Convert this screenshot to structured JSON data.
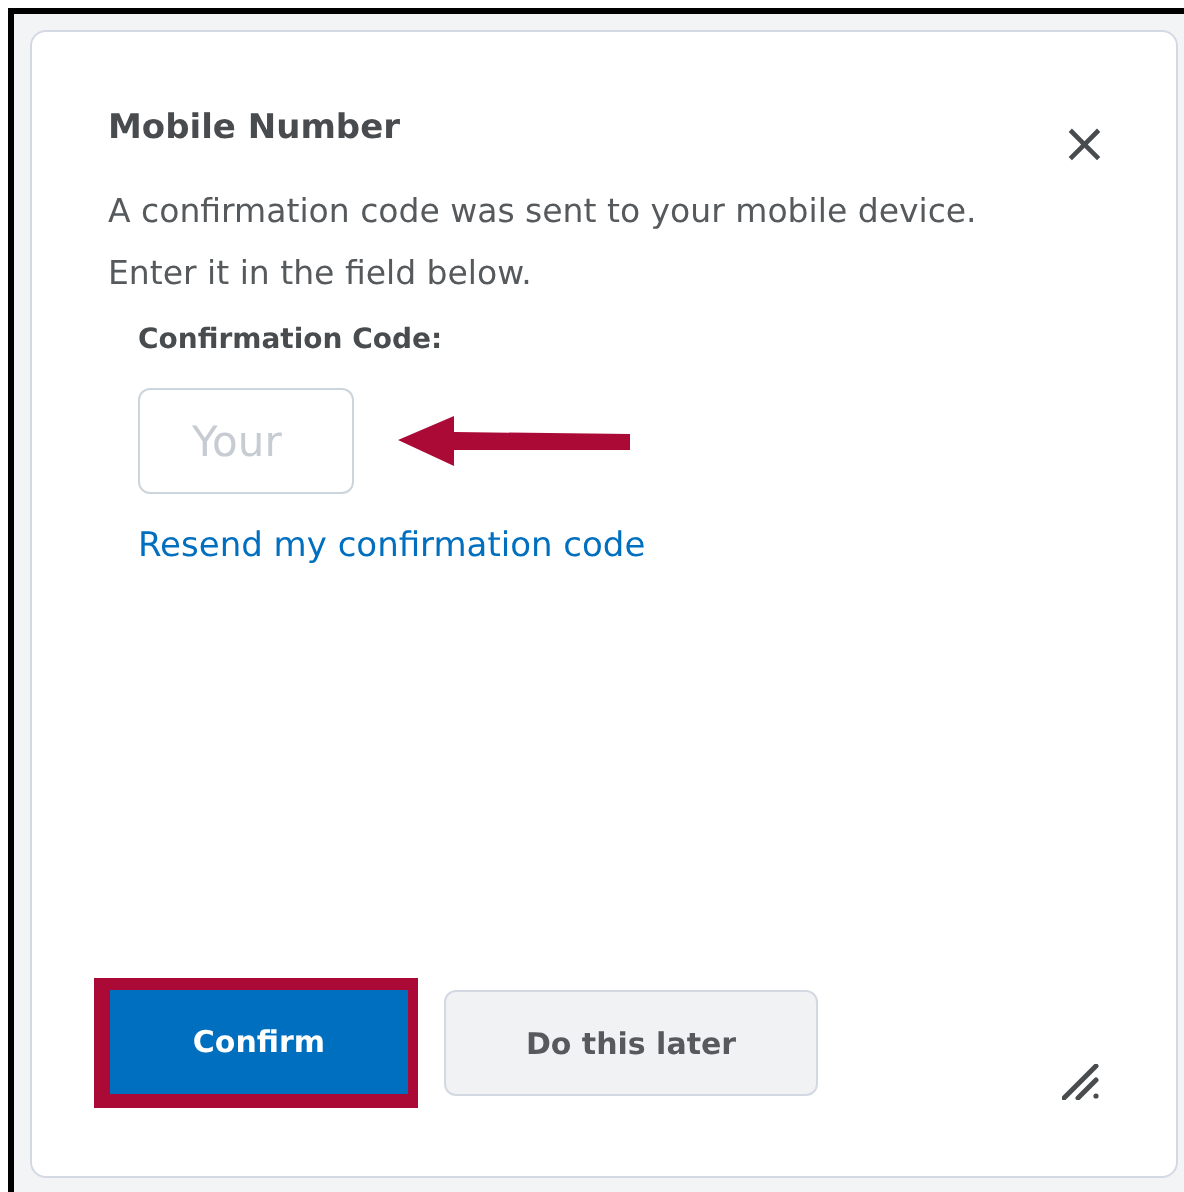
{
  "dialog": {
    "title": "Mobile Number",
    "close": "×",
    "message": "A confirmation code was sent to your mobile device. Enter it in the field below.",
    "field": {
      "label": "Confirmation Code:",
      "placeholder": "Your"
    },
    "link": "Resend my confirmation code"
  },
  "buttons": [
    {
      "label": "Confirm",
      "kind": "primary",
      "highlighted": true
    },
    {
      "label": "Do this later",
      "kind": "secondary",
      "highlighted": false
    }
  ]
}
